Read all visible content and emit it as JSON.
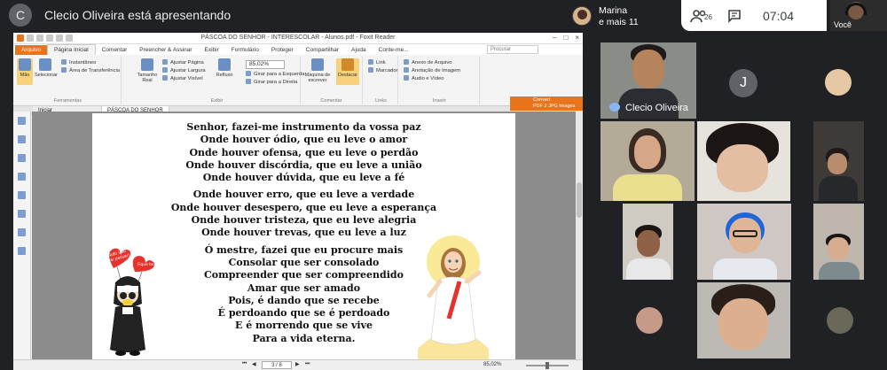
{
  "meet": {
    "presenter_initial": "C",
    "presenter_text": "Clecio Oliveira está apresentando",
    "participant_name": "Marina",
    "participant_more": "e mais 11",
    "people_count": "26",
    "time": "07:04",
    "self_label": "Você"
  },
  "foxit": {
    "title": "PÁSCOA DO SENHOR - INTERESCOLAR - Alunos.pdf - Foxit Reader",
    "tabs": [
      "Arquivo",
      "Página Inicial",
      "Comentar",
      "Preencher & Assinar",
      "Exibir",
      "Formulário",
      "Proteger",
      "Compartilhar",
      "Ajuda",
      "Conte-me..."
    ],
    "search_placeholder": "Procurar",
    "ribbon": {
      "mao": "Mão",
      "selecionar": "Selecionar",
      "instantaneo": "Instantâneo",
      "area_transf": "Área de Transferência",
      "grp_ferramentas": "Ferramentas",
      "tamanho_real": "Tamanho Real",
      "ajustar_pagina": "Ajustar Página",
      "ajustar_largura": "Ajustar Largura",
      "ajustar_visivel": "Ajustar Visível",
      "refluxo": "Refluxo",
      "zoom": "85,02%",
      "girar_esq": "Girar para a Esquerda",
      "girar_dir": "Girar para a Direita",
      "grp_exibir": "Exibir",
      "maquina": "Máquina de escrever",
      "destacar": "Destacar",
      "grp_comentar": "Comentar",
      "link": "Link",
      "marcador": "Marcador",
      "grp_links": "Links",
      "anexo": "Anexo de Arquivo",
      "anotacao": "Anotação de Imagem",
      "audio": "Áudio e Vídeo",
      "grp_inserir": "Inserir"
    },
    "doc_tabs": [
      "Iniciar",
      "PÁSCOA DO SENHOR -..."
    ],
    "convert_line1": "Convert",
    "convert_line2": "PDF 2 JPG Images",
    "poem_block1": [
      "Senhor, fazei-me instrumento da vossa paz",
      "Onde houver ódio, que eu leve o amor",
      "Onde houver ofensa, que eu leve o perdão",
      "Onde houver discórdia, que eu leve a união",
      "Onde houver dúvida, que eu leve a fé"
    ],
    "poem_block2": [
      "Onde houver erro, que eu leve a verdade",
      "Onde houver desespero, que eu leve a esperança",
      "Onde houver tristeza, que eu leve alegria",
      "Onde houver trevas, que eu leve a luz"
    ],
    "poem_block3": [
      "Ó mestre, fazei que eu procure mais",
      "Consolar que ser consolado",
      "Compreender que ser compreendido",
      "Amar que ser amado",
      "Pois, é dando que se recebe",
      "É perdoando que se é perdoado",
      "E é morrendo que se vive",
      "Para a vida eterna."
    ],
    "balloons": [
      "Tudo isso",
      "vai passar!",
      "Fique bem!"
    ],
    "page_indicator": "3 / 8",
    "status_zoom": "85,02%"
  },
  "grid": {
    "main_name": "Clecio Oliveira",
    "j_initial": "J"
  }
}
